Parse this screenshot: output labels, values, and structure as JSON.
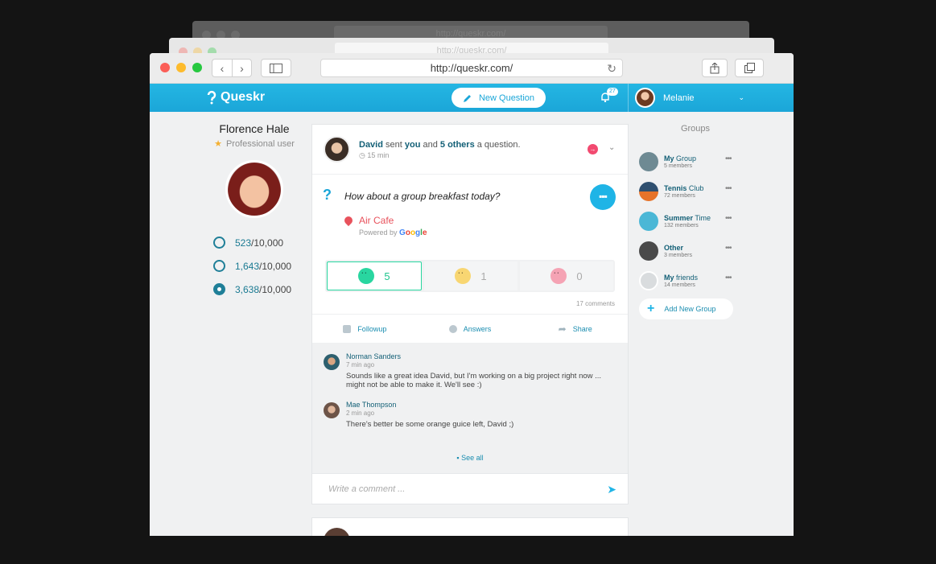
{
  "browser": {
    "url": "http://queskr.com/",
    "ghost_url": "http://queskr.com/"
  },
  "app": {
    "logo_text": "Queskr",
    "new_question_label": "New Question",
    "notification_count": "27",
    "user_name": "Melanie"
  },
  "profile": {
    "name": "Florence Hale",
    "role": "Professional user",
    "stats": [
      {
        "value": "523",
        "max": "/10,000"
      },
      {
        "value": "1,643",
        "max": "/10,000"
      },
      {
        "value": "3,638",
        "max": "/10,000"
      }
    ]
  },
  "post": {
    "sender": "David",
    "text_sent": " sent ",
    "you": "you",
    "text_and": " and ",
    "others": "5 others",
    "text_question": " a question.",
    "time": "15 min",
    "question": "How about a group breakfast today?",
    "more_label": "▪▪▪",
    "place": "Air Cafe",
    "powered_by": "Powered by",
    "google": "Google",
    "votes": [
      {
        "count": "5"
      },
      {
        "count": "1"
      },
      {
        "count": "0"
      }
    ],
    "comments_count": "17 comments",
    "actions": {
      "followup": "Followup",
      "answers": "Answers",
      "share": "Share"
    },
    "comments": [
      {
        "name": "Norman Sanders",
        "time": "7 min ago",
        "body": "Sounds like a great idea David, but I'm working on a big project right now ... might not be able to make it. We'll see :)"
      },
      {
        "name": "Mae Thompson",
        "time": "2 min ago",
        "body": "There's better be some orange guice left, David ;)"
      }
    ],
    "see_all": "See all",
    "comment_placeholder": "Write a comment ..."
  },
  "groups": {
    "title": "Groups",
    "items": [
      {
        "name_bold": "My",
        "name_rest": " Group",
        "members": "5 members",
        "color": "#6e8a93"
      },
      {
        "name_bold": "Tennis",
        "name_rest": " Club",
        "members": "72 members",
        "color": "#2f4f6f"
      },
      {
        "name_bold": "Summer",
        "name_rest": " Time",
        "members": "132 members",
        "color": "#4bb7d6"
      },
      {
        "name_bold": "Other",
        "name_rest": "",
        "members": "3 members",
        "color": "#4a4a4a"
      },
      {
        "name_bold": "My",
        "name_rest": " friends",
        "members": "14 members",
        "color": "#d9dcde"
      }
    ],
    "add_label": "Add New Group"
  }
}
